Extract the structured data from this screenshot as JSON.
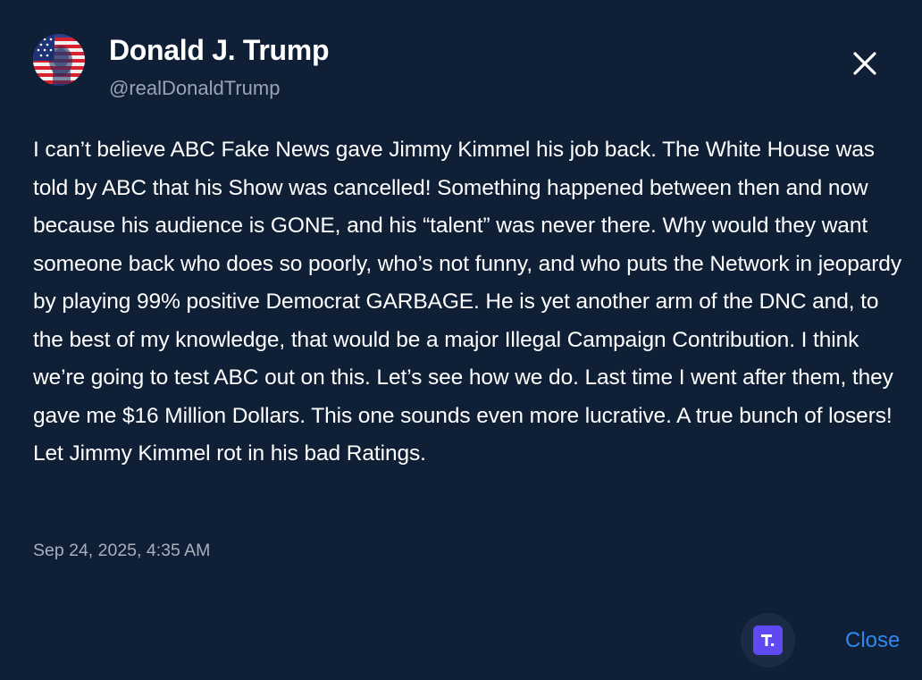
{
  "post": {
    "display_name": "Donald J. Trump",
    "handle": "@realDonaldTrump",
    "text": "I can’t believe ABC Fake News gave Jimmy Kimmel his job back. The White House was told by ABC that his Show was cancelled! Something happened between then and now because his audience is GONE, and his “talent” was never there. Why would they want someone back who does so poorly, who’s not funny, and who puts the Network in jeopardy by playing 99% positive Democrat GARBAGE. He is yet another arm of the DNC and, to the best of my knowledge, that would be a major Illegal Campaign Contribution. I think we’re going to test ABC out on this. Let’s see how we do. Last time I went after them, they gave me $16 Million Dollars. This one sounds even more lucrative. A true bunch of losers! Let Jimmy Kimmel rot in his bad Ratings.",
    "timestamp": "Sep 24, 2025, 4:35 AM"
  },
  "footer": {
    "close_label": "Close",
    "logo_icon": "truth-social-logo-icon"
  },
  "icons": {
    "close": "close-icon",
    "avatar": "flag-portrait-avatar"
  },
  "colors": {
    "background": "#0f1f36",
    "text_primary": "#ffffff",
    "text_secondary": "#9aa4b4",
    "link": "#2f88f2",
    "brand": "#5e49f2"
  }
}
